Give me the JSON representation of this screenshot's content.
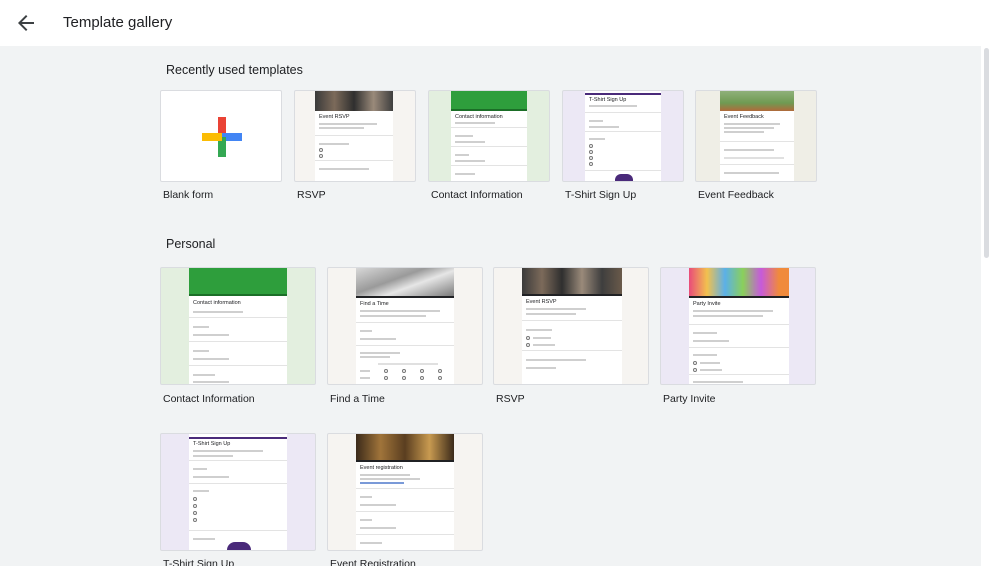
{
  "header": {
    "title": "Template gallery",
    "back_icon": "arrow-left-icon"
  },
  "sections": {
    "recent": {
      "title": "Recently used templates",
      "items": [
        {
          "label": "Blank form"
        },
        {
          "label": "RSVP",
          "form_title": "Event RSVP"
        },
        {
          "label": "Contact Information",
          "form_title": "Contact information"
        },
        {
          "label": "T-Shirt Sign Up",
          "form_title": "T-Shirt Sign Up"
        },
        {
          "label": "Event Feedback",
          "form_title": "Event Feedback"
        }
      ]
    },
    "personal": {
      "title": "Personal",
      "items": [
        {
          "label": "Contact Information",
          "form_title": "Contact information"
        },
        {
          "label": "Find a Time",
          "form_title": "Find a Time"
        },
        {
          "label": "RSVP",
          "form_title": "Event RSVP"
        },
        {
          "label": "Party Invite",
          "form_title": "Party Invite"
        },
        {
          "label": "T-Shirt Sign Up",
          "form_title": "T-Shirt Sign Up"
        },
        {
          "label": "Event Registration",
          "form_title": "Event registration"
        }
      ]
    }
  },
  "colors": {
    "contact_green": "#2e9e3c",
    "tshirt_purple": "#4a2a7a",
    "page_bg": "#f1f3f4",
    "plus_blue": "#4285f4",
    "plus_red": "#ea4335",
    "plus_yellow": "#fbbc04",
    "plus_green": "#34a853"
  }
}
